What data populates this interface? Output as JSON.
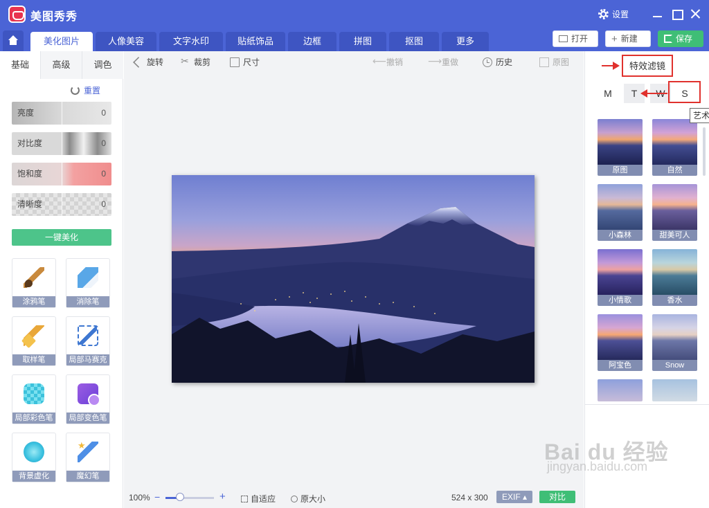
{
  "titlebar": {
    "app_title": "美图秀秀",
    "settings_label": "设置"
  },
  "nav": {
    "tabs": [
      "美化图片",
      "人像美容",
      "文字水印",
      "贴纸饰品",
      "边框",
      "拼图",
      "抠图",
      "更多"
    ],
    "open_label": "打开",
    "new_label": "新建",
    "save_label": "保存"
  },
  "left": {
    "subtabs": [
      "基础",
      "高级",
      "调色"
    ],
    "reset_label": "重置",
    "sliders": [
      {
        "label": "亮度",
        "value": "0"
      },
      {
        "label": "对比度",
        "value": "0"
      },
      {
        "label": "饱和度",
        "value": "0"
      },
      {
        "label": "清晰度",
        "value": "0"
      }
    ],
    "one_key_label": "一键美化",
    "tools": [
      "涂鸦笔",
      "消除笔",
      "取样笔",
      "局部马赛克",
      "局部彩色笔",
      "局部变色笔",
      "背景虚化",
      "魔幻笔"
    ]
  },
  "toolbar": {
    "rotate": "旋转",
    "crop": "裁剪",
    "size": "尺寸",
    "undo": "撤销",
    "redo": "重做",
    "history": "历史",
    "original": "原图"
  },
  "status": {
    "zoom": "100%",
    "zoom_level": 0.3,
    "fit": "自适应",
    "actual_size": "原大小",
    "dimensions": "524 x 300",
    "exif": "EXIF ▴",
    "compare": "对比"
  },
  "right": {
    "fx_title": "特效滤镜",
    "letters": [
      "M",
      "T",
      "W",
      "S"
    ],
    "tooltip": "艺术",
    "filters": [
      "原图",
      "自然",
      "小森林",
      "甜美可人",
      "小情歌",
      "香水",
      "阿宝色",
      "Snow"
    ]
  },
  "watermark": {
    "main": "Bai du 经验",
    "sub": "jingyan.baidu.com"
  },
  "colors": {
    "brand": "#4b64d6",
    "accent_green": "#3fbe76",
    "highlight_red": "#e0312d"
  }
}
